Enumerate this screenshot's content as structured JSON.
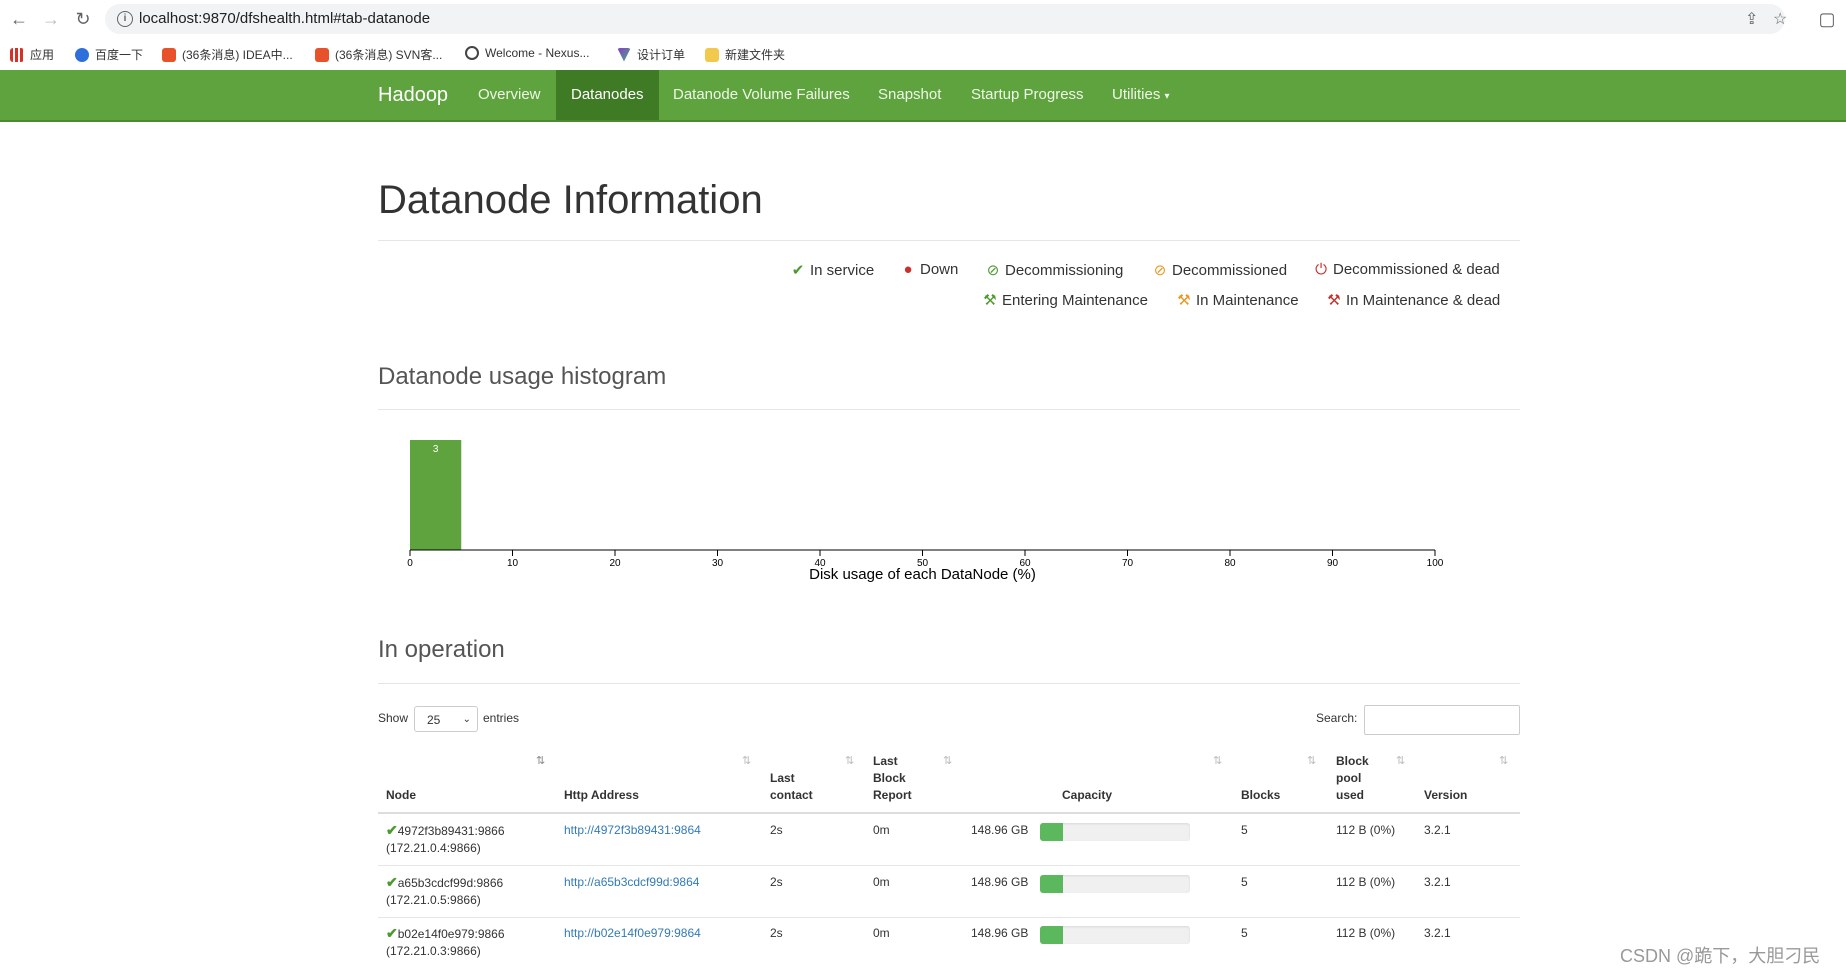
{
  "browser": {
    "url": "localhost:9870/dfshealth.html#tab-datanode",
    "bookmarks": [
      {
        "label": "应用",
        "color": "#d93025"
      },
      {
        "label": "百度一下",
        "color": "#2f6fdc"
      },
      {
        "label": "(36条消息) IDEA中...",
        "color": "#e8522a"
      },
      {
        "label": "(36条消息) SVN客...",
        "color": "#e8522a"
      },
      {
        "label": "Welcome - Nexus...",
        "color": "#444"
      },
      {
        "label": "设计订单",
        "color": "#8a3cc8"
      },
      {
        "label": "新建文件夹",
        "color": "#f2c94c"
      }
    ]
  },
  "navbar": {
    "brand": "Hadoop",
    "links": [
      "Overview",
      "Datanodes",
      "Datanode Volume Failures",
      "Snapshot",
      "Startup Progress",
      "Utilities"
    ],
    "active": "Datanodes"
  },
  "page": {
    "title": "Datanode Information",
    "legend": [
      {
        "label": "In service",
        "symbol": "✔",
        "color": "#4a9a2c"
      },
      {
        "label": "Down",
        "symbol": "●",
        "color": "#c9302c"
      },
      {
        "label": "Decommissioning",
        "symbol": "⊘",
        "color": "#4a9a2c"
      },
      {
        "label": "Decommissioned",
        "symbol": "⊘",
        "color": "#ec971f"
      },
      {
        "label": "Decommissioned & dead",
        "symbol": "⏻",
        "color": "#c9302c"
      },
      {
        "label": "Entering Maintenance",
        "symbol": "🔧",
        "color": "#4a9a2c"
      },
      {
        "label": "In Maintenance",
        "symbol": "🔧",
        "color": "#ec971f"
      },
      {
        "label": "In Maintenance & dead",
        "symbol": "🔧",
        "color": "#c9302c"
      }
    ],
    "histogram_title": "Datanode usage histogram",
    "operation_title": "In operation"
  },
  "chart_data": {
    "type": "bar",
    "xlabel": "Disk usage of each DataNode (%)",
    "ticks": [
      0,
      10,
      20,
      30,
      40,
      50,
      60,
      70,
      80,
      90,
      100
    ],
    "xlim": [
      0,
      100
    ],
    "bins": [
      {
        "from": 0,
        "to": 5,
        "count": 3
      }
    ],
    "bar_color": "#5fa33e"
  },
  "table": {
    "show_label": "Show",
    "entries_value": "25",
    "entries_label": "entries",
    "search_label": "Search:",
    "headers": {
      "node": "Node",
      "http": "Http Address",
      "last_contact": [
        "Last",
        "contact"
      ],
      "last_block_report": [
        "Last",
        "Block",
        "Report"
      ],
      "capacity": "Capacity",
      "blocks": "Blocks",
      "block_pool_used": [
        "Block",
        "pool",
        "used"
      ],
      "version": "Version"
    },
    "rows": [
      {
        "node": "4972f3b89431:9866",
        "ip": "(172.21.0.4:9866)",
        "http": "http://4972f3b89431:9864",
        "last_contact": "2s",
        "last_block_report": "0m",
        "capacity": "148.96 GB",
        "usage_pct": 15,
        "blocks": "5",
        "block_pool_used": "112 B (0%)",
        "version": "3.2.1"
      },
      {
        "node": "a65b3cdcf99d:9866",
        "ip": "(172.21.0.5:9866)",
        "http": "http://a65b3cdcf99d:9864",
        "last_contact": "2s",
        "last_block_report": "0m",
        "capacity": "148.96 GB",
        "usage_pct": 15,
        "blocks": "5",
        "block_pool_used": "112 B (0%)",
        "version": "3.2.1"
      },
      {
        "node": "b02e14f0e979:9866",
        "ip": "(172.21.0.3:9866)",
        "http": "http://b02e14f0e979:9864",
        "last_contact": "2s",
        "last_block_report": "0m",
        "capacity": "148.96 GB",
        "usage_pct": 15,
        "blocks": "5",
        "block_pool_used": "112 B (0%)",
        "version": "3.2.1"
      }
    ]
  },
  "watermark": "CSDN @跪下，大胆刁民"
}
